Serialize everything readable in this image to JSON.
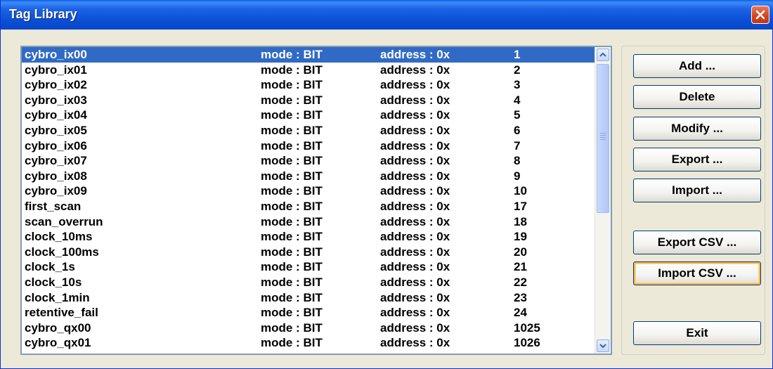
{
  "window": {
    "title": "Tag Library",
    "close_icon": "close-icon"
  },
  "list": {
    "rows": [
      {
        "name": "cybro_ix00",
        "mode": "mode : BIT",
        "address": "address :  0x",
        "value": "1"
      },
      {
        "name": "cybro_ix01",
        "mode": "mode : BIT",
        "address": "address :  0x",
        "value": "2"
      },
      {
        "name": "cybro_ix02",
        "mode": "mode : BIT",
        "address": "address :  0x",
        "value": "3"
      },
      {
        "name": "cybro_ix03",
        "mode": "mode : BIT",
        "address": "address :  0x",
        "value": "4"
      },
      {
        "name": "cybro_ix04",
        "mode": "mode : BIT",
        "address": "address :  0x",
        "value": "5"
      },
      {
        "name": "cybro_ix05",
        "mode": "mode : BIT",
        "address": "address :  0x",
        "value": "6"
      },
      {
        "name": "cybro_ix06",
        "mode": "mode : BIT",
        "address": "address :  0x",
        "value": "7"
      },
      {
        "name": "cybro_ix07",
        "mode": "mode : BIT",
        "address": "address :  0x",
        "value": "8"
      },
      {
        "name": "cybro_ix08",
        "mode": "mode : BIT",
        "address": "address :  0x",
        "value": "9"
      },
      {
        "name": "cybro_ix09",
        "mode": "mode : BIT",
        "address": "address :  0x",
        "value": "10"
      },
      {
        "name": "first_scan",
        "mode": "mode : BIT",
        "address": "address :  0x",
        "value": "17"
      },
      {
        "name": "scan_overrun",
        "mode": "mode : BIT",
        "address": "address :  0x",
        "value": "18"
      },
      {
        "name": "clock_10ms",
        "mode": "mode : BIT",
        "address": "address :  0x",
        "value": "19"
      },
      {
        "name": "clock_100ms",
        "mode": "mode : BIT",
        "address": "address :  0x",
        "value": "20"
      },
      {
        "name": "clock_1s",
        "mode": "mode : BIT",
        "address": "address :  0x",
        "value": "21"
      },
      {
        "name": "clock_10s",
        "mode": "mode : BIT",
        "address": "address :  0x",
        "value": "22"
      },
      {
        "name": "clock_1min",
        "mode": "mode : BIT",
        "address": "address :  0x",
        "value": "23"
      },
      {
        "name": "retentive_fail",
        "mode": "mode : BIT",
        "address": "address :  0x",
        "value": "24"
      },
      {
        "name": "cybro_qx00",
        "mode": "mode : BIT",
        "address": "address :  0x",
        "value": "1025"
      },
      {
        "name": "cybro_qx01",
        "mode": "mode : BIT",
        "address": "address :  0x",
        "value": "1026"
      }
    ],
    "selected_index": 0,
    "scroll_up_icon": "scroll-up-arrow-icon",
    "scroll_down_icon": "scroll-down-arrow-icon"
  },
  "buttons": {
    "add": "Add ...",
    "delete": "Delete",
    "modify": "Modify ...",
    "export": "Export ...",
    "import": "Import ...",
    "export_csv": "Export CSV ...",
    "import_csv": "Import CSV ...",
    "exit": "Exit"
  },
  "colors": {
    "titlebar": "#0a4fd6",
    "selection": "#316ac5",
    "window_bg": "#ece9d8",
    "close_button": "#d4421d"
  }
}
